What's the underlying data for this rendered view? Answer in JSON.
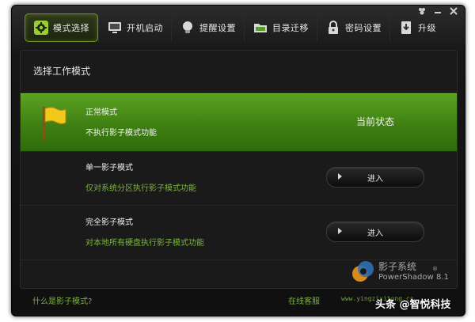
{
  "window": {
    "controls": [
      "menu-icon",
      "minimize-icon",
      "close-icon"
    ]
  },
  "tabs": [
    {
      "label": "模式选择",
      "icon": "gear-icon",
      "active": true
    },
    {
      "label": "开机启动",
      "icon": "monitor-icon",
      "active": false
    },
    {
      "label": "提醒设置",
      "icon": "bulb-icon",
      "active": false
    },
    {
      "label": "目录迁移",
      "icon": "folder-icon",
      "active": false
    },
    {
      "label": "密码设置",
      "icon": "lock-icon",
      "active": false
    },
    {
      "label": "升级",
      "icon": "download-icon",
      "active": false
    }
  ],
  "panel": {
    "title": "选择工作模式",
    "modes": [
      {
        "name": "正常模式",
        "desc": "不执行影子模式功能",
        "status": "当前状态",
        "icon": "yellow-flag-icon"
      },
      {
        "name": "单一影子模式",
        "desc": "仅对系统分区执行影子模式功能",
        "button": "进入"
      },
      {
        "name": "完全影子模式",
        "desc": "对本地所有硬盘执行影子模式功能",
        "button": "进入"
      }
    ]
  },
  "logo": {
    "cn": "影子系统",
    "en": "PowerShadow",
    "version": "8.1",
    "reg": "®"
  },
  "footer": {
    "help_link": "什么是影子模式?",
    "online_service": "在线客服",
    "website": "www.yingzixitong.cn"
  },
  "watermark": "头条 @智悦科技",
  "colors": {
    "accent_green": "#4f9419",
    "link_green": "#79b53a",
    "background": "#101010"
  }
}
